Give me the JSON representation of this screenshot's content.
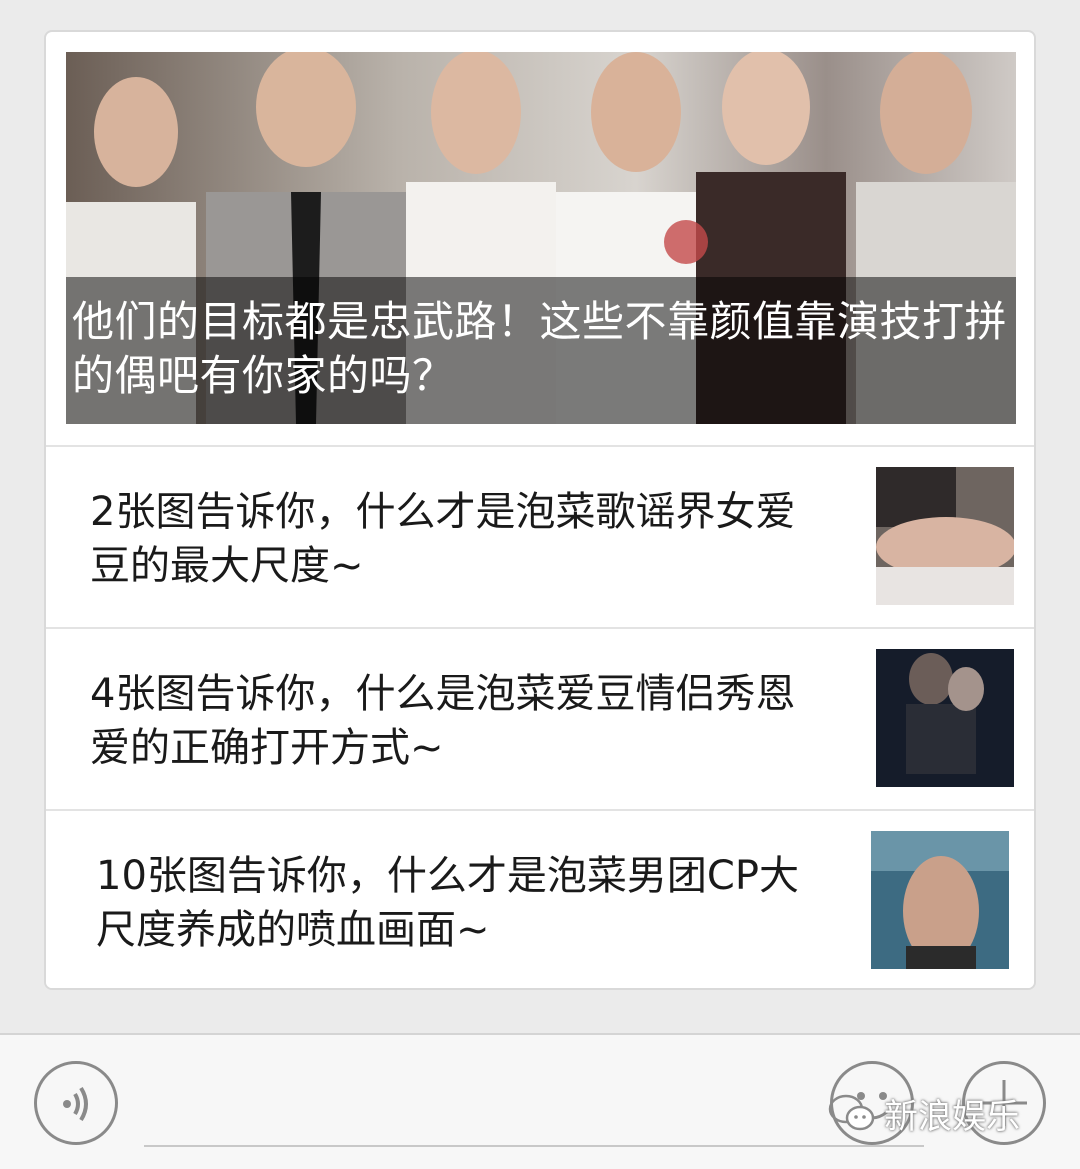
{
  "feed": {
    "cover_story": {
      "title": "他们的目标都是忠武路！这些不靠颜值靠演技打拼的偶吧有你家的吗？"
    },
    "stories": [
      {
        "title": "2张图告诉你，什么才是泡菜歌谣界女爱豆的最大尺度~"
      },
      {
        "title": "4张图告诉你，什么是泡菜爱豆情侣秀恩爱的正确打开方式~"
      },
      {
        "title": "10张图告诉你，什么才是泡菜男团CP大尺度养成的喷血画面~"
      }
    ]
  },
  "input_bar": {
    "voice_icon": "voice-icon",
    "emoji_icon": "emoji-icon",
    "add_icon": "plus-icon"
  },
  "watermark": {
    "text": "新浪娱乐"
  },
  "colors": {
    "background": "#ebebeb",
    "card": "#ffffff",
    "caption_overlay": "rgba(0,0,0,0.5)",
    "text": "#1a1a1a"
  }
}
